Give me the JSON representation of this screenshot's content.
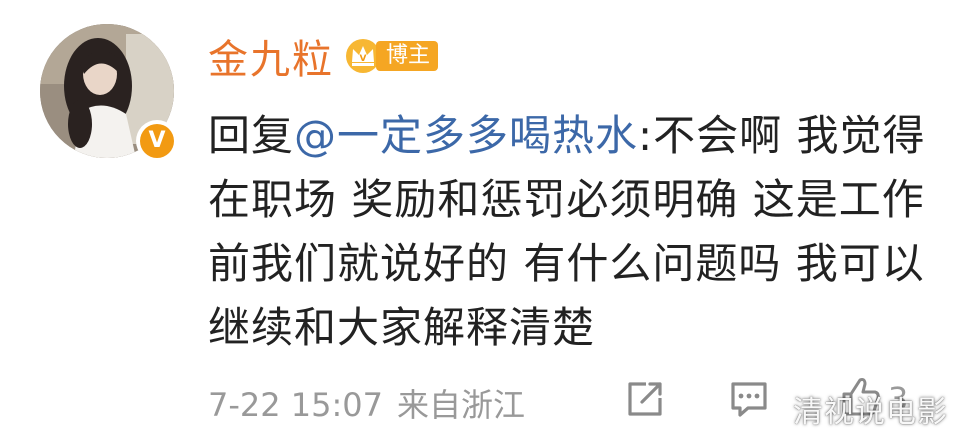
{
  "user": {
    "name": "金九粒",
    "badge_label": "博主",
    "verified_mark": "V",
    "icons": {
      "crown": "crown-icon",
      "verified": "verified-v-badge"
    }
  },
  "comment": {
    "reply_prefix": "回复",
    "mention": "@一定多多喝热水",
    "text": ":不会啊 我觉得在职场 奖励和惩罚必须明确 这是工作前我们就说好的 有什么问题吗 我可以继续和大家解释清楚"
  },
  "footer": {
    "timestamp": "7-22 15:07",
    "source": "来自浙江",
    "like_count": "3",
    "icons": {
      "share": "share-icon",
      "comment": "comment-icon",
      "like": "like-icon"
    }
  },
  "watermark": "清视说电影",
  "colors": {
    "username": "#e8742b",
    "mention": "#3c68a8",
    "badge": "#f5a623",
    "verified": "#f29a12",
    "meta": "#999999",
    "body_text": "#222222"
  }
}
